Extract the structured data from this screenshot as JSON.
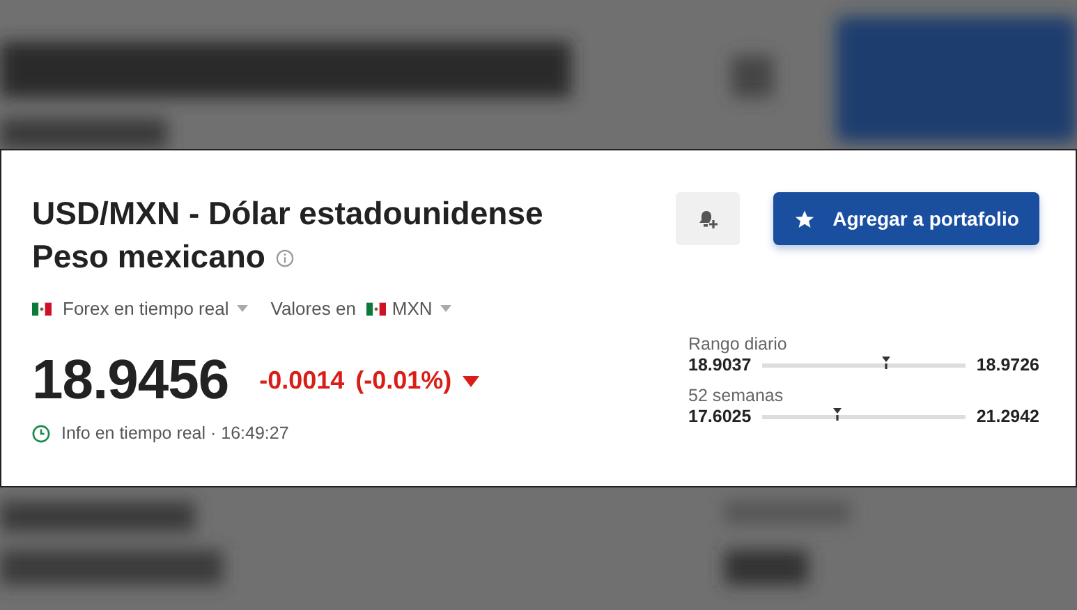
{
  "title": {
    "line_1": "USD/MXN - Dólar estadounidense",
    "line_2": "Peso mexicano"
  },
  "market": {
    "label": "Forex en tiempo real",
    "values_label": "Valores en",
    "currency": "MXN"
  },
  "portfolio_button": {
    "label": "Agregar a portafolio"
  },
  "price": {
    "value": "18.9456",
    "change": "-0.0014",
    "change_percent": "(-0.01%)",
    "kind": "down",
    "status": "Info en tiempo real · 16:49:27"
  },
  "ranges": [
    {
      "label": "Rango diario",
      "low": "18.9037",
      "high": "18.9726",
      "level": 0.61
    },
    {
      "label": "52 semanas",
      "low": "17.6025",
      "high": "21.2942",
      "level": 0.37
    }
  ]
}
